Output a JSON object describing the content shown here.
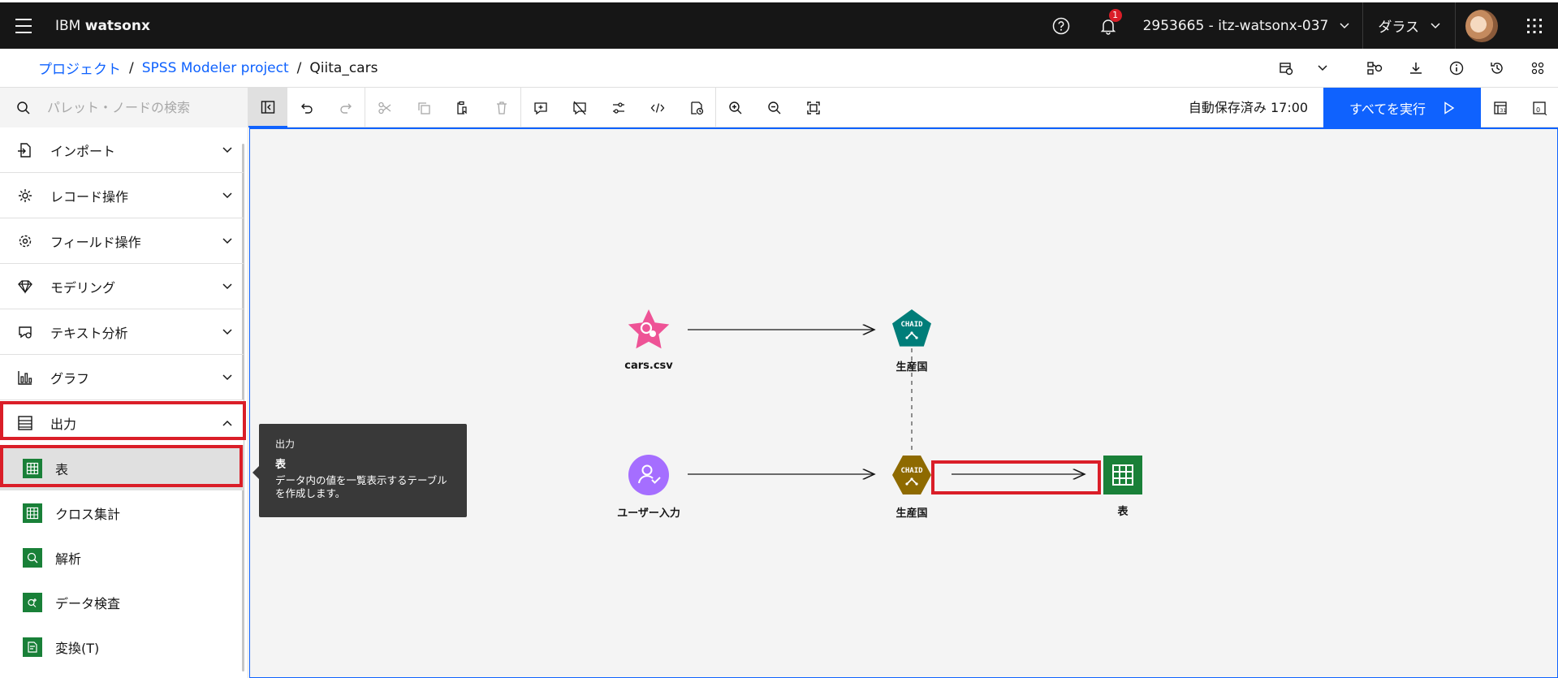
{
  "header": {
    "brand_prefix": "IBM",
    "brand_name": "watsonx",
    "notification_count": "1",
    "account": "2953665 - itz-watsonx-037",
    "region": "ダラス"
  },
  "breadcrumb": {
    "items": [
      "プロジェクト",
      "SPSS Modeler project"
    ],
    "current": "Qiita_cars"
  },
  "toolbar": {
    "search_placeholder": "パレット・ノードの検索",
    "autosave": "自動保存済み 17:00",
    "run_all": "すべてを実行"
  },
  "sidebar": {
    "categories": [
      {
        "label": "インポート",
        "icon": "import-icon"
      },
      {
        "label": "レコード操作",
        "icon": "record-ops-icon"
      },
      {
        "label": "フィールド操作",
        "icon": "field-ops-icon"
      },
      {
        "label": "モデリング",
        "icon": "diamond-icon"
      },
      {
        "label": "テキスト分析",
        "icon": "text-analysis-icon"
      },
      {
        "label": "グラフ",
        "icon": "chart-icon"
      },
      {
        "label": "出力",
        "icon": "output-icon"
      }
    ],
    "output_items": [
      {
        "label": "表",
        "icon": "table-icon"
      },
      {
        "label": "クロス集計",
        "icon": "matrix-icon"
      },
      {
        "label": "解析",
        "icon": "analysis-icon"
      },
      {
        "label": "データ検査",
        "icon": "data-audit-icon"
      },
      {
        "label": "変換(T)",
        "icon": "transform-icon"
      }
    ]
  },
  "tooltip": {
    "category": "出力",
    "title": "表",
    "description": "データ内の値を一覧表示するテーブルを作成します。"
  },
  "canvas": {
    "nodes": [
      {
        "label": "cars.csv",
        "icon": "star-source-icon",
        "color": "#ee5396"
      },
      {
        "label": "生産国",
        "icon": "chaid-model-icon",
        "color": "#007d79",
        "badge": "CHAID"
      },
      {
        "label": "ユーザー入力",
        "icon": "user-input-icon",
        "color": "#a56eff"
      },
      {
        "label": "生産国",
        "icon": "chaid-nugget-icon",
        "color": "#8e6a00",
        "badge": "CHAID"
      },
      {
        "label": "表",
        "icon": "table-output-icon",
        "color": "#198038"
      }
    ]
  },
  "colors": {
    "accent": "#0f62fe",
    "highlight": "#da1e28",
    "header_bg": "#161616"
  }
}
